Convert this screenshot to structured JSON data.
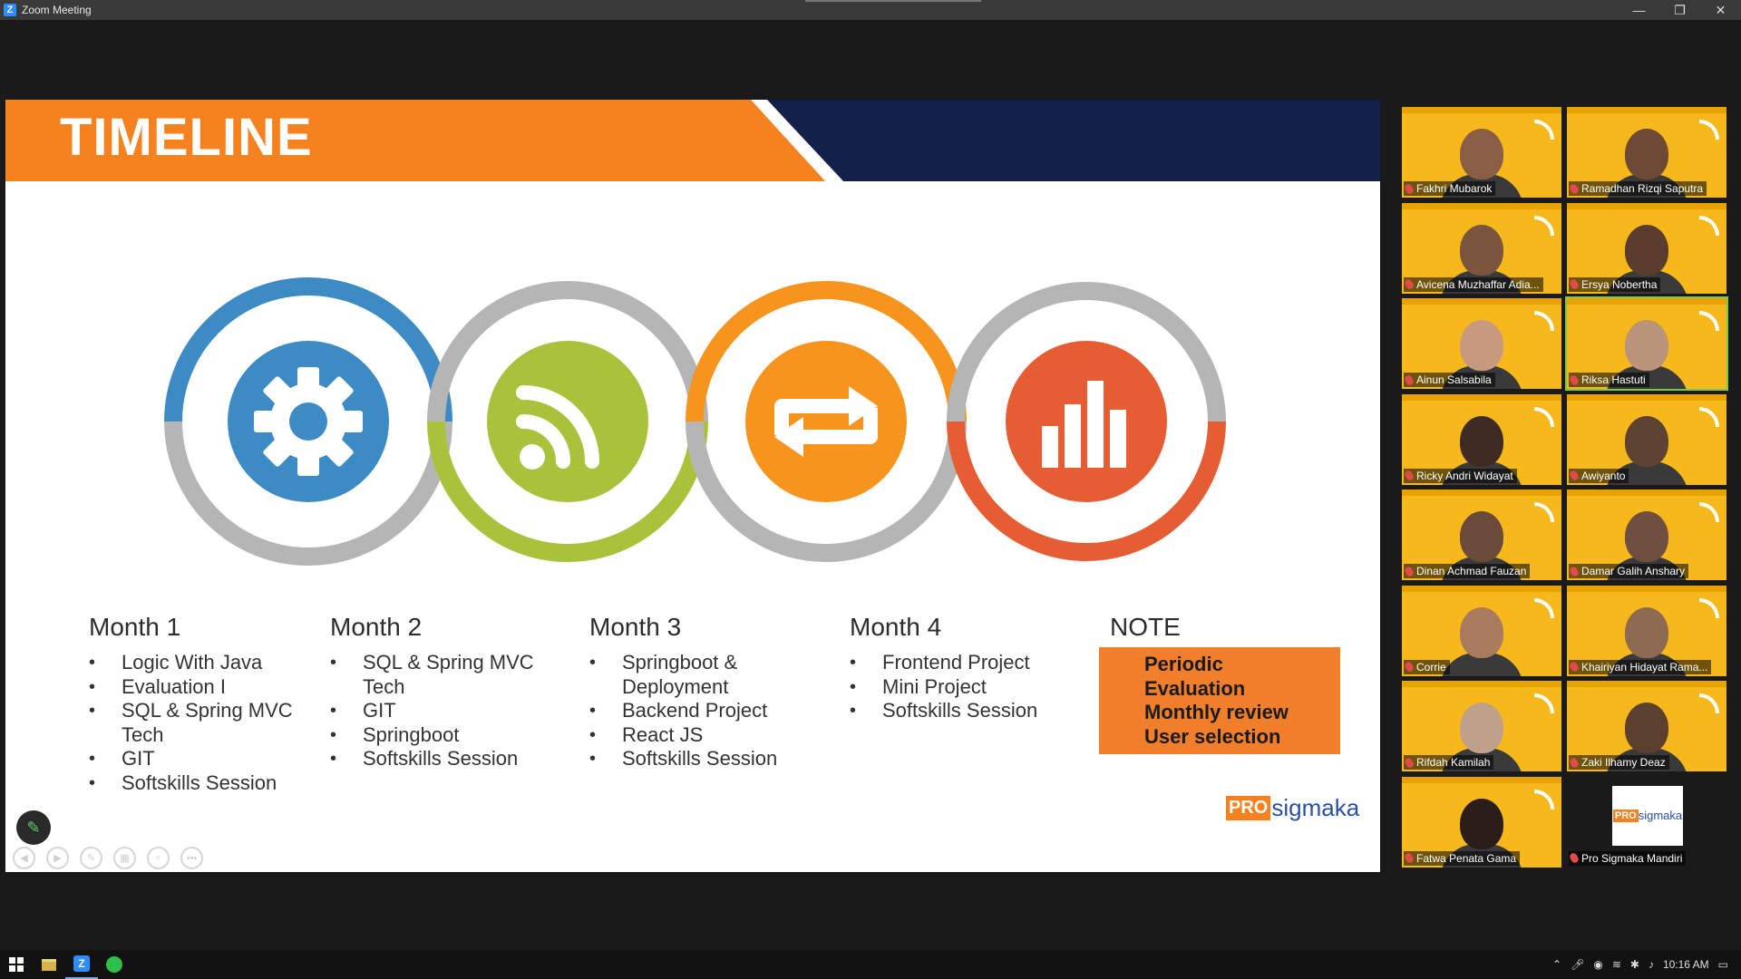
{
  "window": {
    "title": "Zoom Meeting",
    "logo_letter": "Z",
    "minimize": "—",
    "restore": "❐",
    "close": "✕"
  },
  "slide": {
    "title": "TIMELINE",
    "colors": {
      "orange": "#f5821f",
      "navy": "#13214a",
      "blue": "#3d8bc4",
      "green": "#a9c23c",
      "amber": "#f7941d",
      "red": "#e65c33",
      "grey": "#b5b5b5"
    },
    "circle_icons": [
      "gear-icon",
      "rss-feed-icon",
      "repeat-icon",
      "bar-chart-icon"
    ],
    "columns": [
      {
        "heading": "Month 1",
        "items": [
          "Logic With Java",
          "Evaluation I",
          "SQL & Spring MVC Tech",
          "GIT",
          "Softskills Session"
        ]
      },
      {
        "heading": "Month 2",
        "items": [
          "SQL & Spring MVC Tech",
          "GIT",
          "Springboot",
          "Softskills Session"
        ]
      },
      {
        "heading": "Month 3",
        "items": [
          "Springboot & Deployment",
          "Backend Project",
          "React JS",
          "Softskills Session"
        ]
      },
      {
        "heading": "Month 4",
        "items": [
          "Frontend Project",
          "Mini Project",
          "Softskills Session"
        ]
      }
    ],
    "note": {
      "heading": "NOTE",
      "items": [
        "Periodic Evaluation",
        "Monthly review",
        "User selection"
      ]
    },
    "logo": {
      "pro": "PRO",
      "rest": "sigmaka"
    }
  },
  "participants": [
    {
      "name": "Fakhri Mubarok"
    },
    {
      "name": "Ramadhan Rizqi Saputra"
    },
    {
      "name": "Avicena Muzhaffar Adia..."
    },
    {
      "name": "Ersya Nobertha"
    },
    {
      "name": "Ainun Salsabila"
    },
    {
      "name": "Riksa Hastuti"
    },
    {
      "name": "Ricky Andri Widayat"
    },
    {
      "name": "Awiyanto"
    },
    {
      "name": "Dinan Achmad Fauzan"
    },
    {
      "name": "Damar Galih Anshary"
    },
    {
      "name": "Corrie"
    },
    {
      "name": "Khairiyan Hidayat Rama..."
    },
    {
      "name": "Rifdah Kamilah"
    },
    {
      "name": "Zaki Ilhamy Deaz"
    },
    {
      "name": "Fatwa Penata Gama"
    },
    {
      "name": "Pro Sigmaka Mandiri"
    }
  ],
  "taskbar": {
    "time": "10:16 AM",
    "zoom_letter": "Z"
  }
}
